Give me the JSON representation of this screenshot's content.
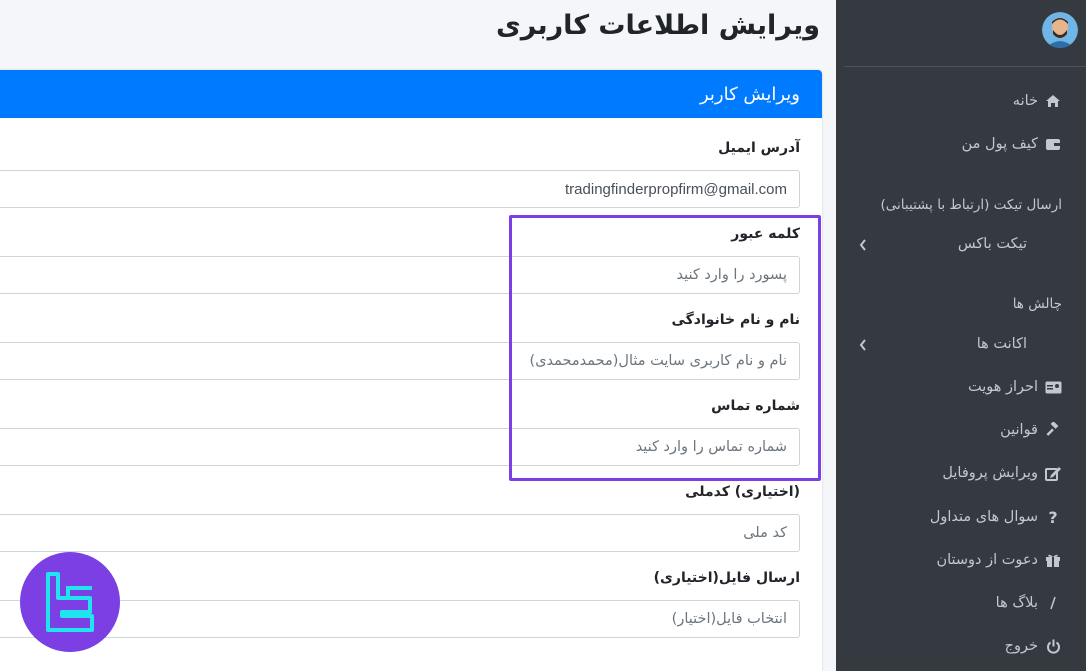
{
  "page": {
    "title": "ویرایش اطلاعات کاربری"
  },
  "card": {
    "header": "ویرایش کاربر"
  },
  "form": {
    "email": {
      "label": "آدرس ایمیل",
      "value": "tradingfinderpropfirm@gmail.com"
    },
    "password": {
      "label": "کلمه عبور",
      "placeholder": "پسورد را وارد کنید"
    },
    "fullname": {
      "label": "نام و نام خانوادگی",
      "placeholder": "نام و نام کاربری سایت مثال(محمدمحمدی)"
    },
    "phone": {
      "label": "شماره تماس",
      "placeholder": "شماره تماس را وارد کنید"
    },
    "national_code": {
      "label": "(اختیاری) کدملی",
      "placeholder": "کد ملی"
    },
    "file": {
      "label": "ارسال فایل(اختیاری)",
      "placeholder": "انتخاب فایل(اختیار)"
    }
  },
  "sidebar": {
    "items": [
      {
        "label": "خانه",
        "icon": "home-icon"
      },
      {
        "label": "کیف پول من",
        "icon": "wallet-icon"
      }
    ],
    "ticket_header": "ارسال تیکت (ارتباط با پشتیبانی)",
    "ticket_box": "تیکت باکس",
    "challenges_header": "چالش ها",
    "accounts": "اکانت ها",
    "items2": [
      {
        "label": "احراز هویت",
        "icon": "id-card-icon"
      },
      {
        "label": "قوانین",
        "icon": "gavel-icon"
      },
      {
        "label": "ویرایش پروفایل",
        "icon": "edit-icon"
      },
      {
        "label": "سوال های متداول",
        "icon": "question-icon"
      },
      {
        "label": "دعوت از دوستان",
        "icon": "gift-icon"
      },
      {
        "label": "بلاگ ها",
        "icon": "blog-icon"
      },
      {
        "label": "خروج",
        "icon": "power-icon"
      }
    ]
  },
  "colors": {
    "primary": "#007bff",
    "sidebar_bg": "#343a40",
    "highlight": "#7b3fe4"
  }
}
